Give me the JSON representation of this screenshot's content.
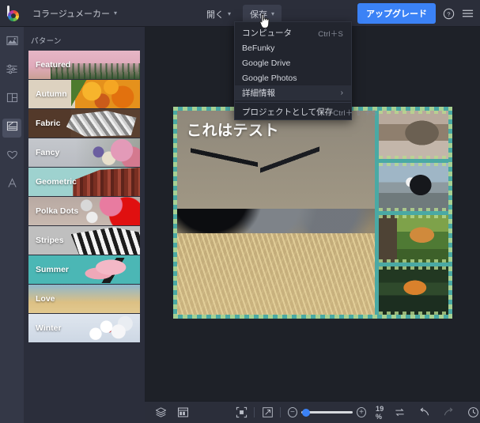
{
  "header": {
    "logo_name": "befunky-logo",
    "app_title": "コラージュメーカー",
    "open_label": "開く",
    "save_label": "保存",
    "upgrade_label": "アップグレード",
    "help_icon": "question-mark-icon",
    "menu_icon": "hamburger-menu-icon",
    "accent_color": "#3b82f6"
  },
  "save_menu": {
    "items": [
      {
        "label": "コンピュータ",
        "shortcut": "Ctrl＋S",
        "arrow": "",
        "highlighted": false
      },
      {
        "label": "BeFunky",
        "shortcut": "",
        "arrow": "",
        "highlighted": false
      },
      {
        "label": "Google Drive",
        "shortcut": "",
        "arrow": "",
        "highlighted": false
      },
      {
        "label": "Google Photos",
        "shortcut": "",
        "arrow": "",
        "highlighted": false
      },
      {
        "label": "詳細情報",
        "shortcut": "",
        "arrow": "›",
        "highlighted": true
      },
      {
        "label": "プロジェクトとして保存",
        "shortcut": "Ctrl＋ ⇧ ＋S",
        "arrow": "",
        "highlighted": false
      }
    ]
  },
  "rail": {
    "items": [
      {
        "icon": "image-icon",
        "selected": false
      },
      {
        "icon": "adjust-sliders-icon",
        "selected": false
      },
      {
        "icon": "layout-grid-icon",
        "selected": false
      },
      {
        "icon": "pattern-icon",
        "selected": true
      },
      {
        "icon": "heart-icon",
        "selected": false
      },
      {
        "icon": "text-a-icon",
        "selected": false
      }
    ]
  },
  "panel": {
    "title": "パターン",
    "items": [
      {
        "label": "Featured",
        "theme": "t-featured"
      },
      {
        "label": "Autumn",
        "theme": "t-autumn"
      },
      {
        "label": "Fabric",
        "theme": "t-fabric"
      },
      {
        "label": "Fancy",
        "theme": "t-fancy"
      },
      {
        "label": "Geometric",
        "theme": "t-geometric"
      },
      {
        "label": "Polka Dots",
        "theme": "t-polka"
      },
      {
        "label": "Stripes",
        "theme": "t-stripes"
      },
      {
        "label": "Summer",
        "theme": "t-summer"
      },
      {
        "label": "Love",
        "theme": "t-love"
      },
      {
        "label": "Winter",
        "theme": "t-winter"
      }
    ]
  },
  "canvas": {
    "overlay_text": "これはテスト",
    "border_color": "#4aa9a4",
    "border_accent_color": "#b8d98f",
    "cells": [
      {
        "name": "main-photo-three-kittens",
        "art": "ph-kittens"
      },
      {
        "name": "side-photo-tabby-cat",
        "art": "ph-cat1"
      },
      {
        "name": "side-photo-black-white-kitten",
        "art": "ph-cat2"
      },
      {
        "name": "side-photo-cat-in-tree",
        "art": "ph-cat3"
      },
      {
        "name": "side-photo-tiger-in-water",
        "art": "ph-tiger"
      }
    ]
  },
  "bottombar": {
    "layers_icon": "layers-icon",
    "panel_toggle_icon": "panel-layout-icon",
    "fit_icon": "fit-to-screen-icon",
    "expand_icon": "expand-fullscreen-icon",
    "zoom_out_label": "−",
    "zoom_in_label": "+",
    "zoom_value": "19 %",
    "swap_icon": "swap-arrows-icon",
    "undo_icon": "undo-arrow-icon",
    "redo_icon": "redo-arrow-icon",
    "history_icon": "history-clock-icon"
  }
}
